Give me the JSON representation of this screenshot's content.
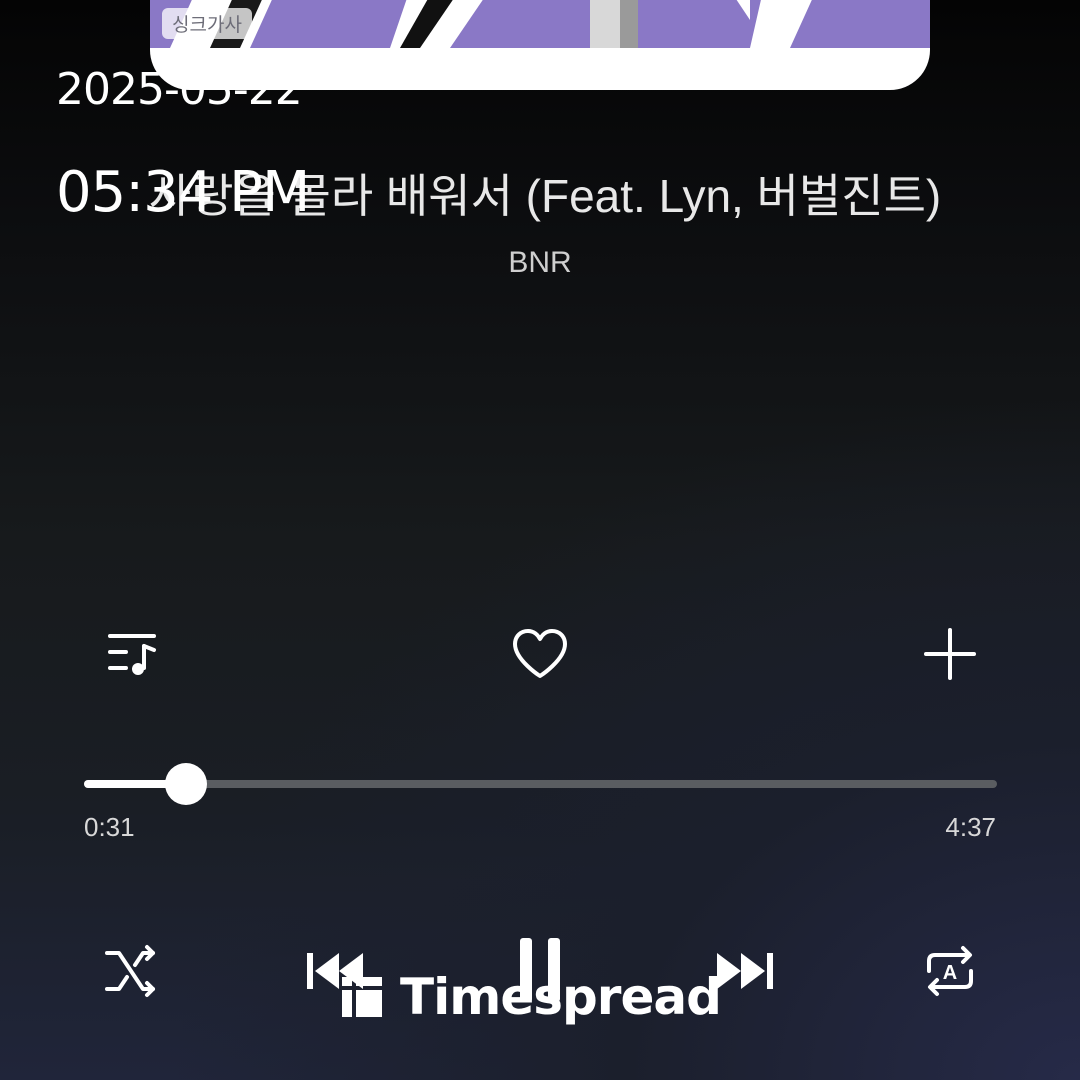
{
  "overlay": {
    "date": "2025-05-22",
    "time": "05:34 PM"
  },
  "album": {
    "badge": "싱크가사",
    "accent_color": "#8a78c6"
  },
  "song": {
    "title": "사랑을 몰라 배워서 (Feat. Lyn, 버벌진트)",
    "artist": "BNR"
  },
  "actions": {
    "playlist_icon": "playlist-music-icon",
    "like_icon": "heart-outline-icon",
    "add_icon": "plus-icon"
  },
  "progress": {
    "current": "0:31",
    "total": "4:37",
    "fraction": 0.112
  },
  "controls": {
    "shuffle_icon": "shuffle-icon",
    "prev_icon": "skip-previous-icon",
    "pause_icon": "pause-icon",
    "next_icon": "skip-next-icon",
    "repeat_icon": "repeat-all-icon",
    "repeat_badge": "A"
  },
  "watermark": {
    "text": "Timespread"
  }
}
